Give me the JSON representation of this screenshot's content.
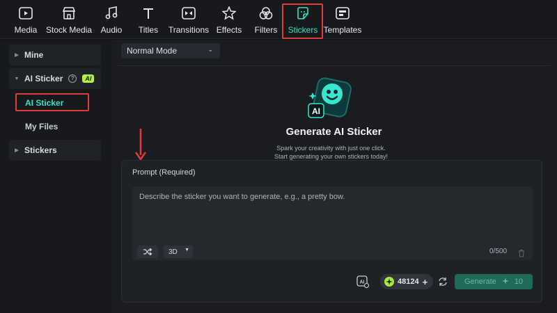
{
  "toolbar": {
    "tabs": [
      {
        "label": "Media",
        "icon": "media-icon"
      },
      {
        "label": "Stock Media",
        "icon": "stock-media-icon"
      },
      {
        "label": "Audio",
        "icon": "music-note-icon"
      },
      {
        "label": "Titles",
        "icon": "titles-icon"
      },
      {
        "label": "Transitions",
        "icon": "transitions-icon"
      },
      {
        "label": "Effects",
        "icon": "effects-icon"
      },
      {
        "label": "Filters",
        "icon": "filters-icon"
      },
      {
        "label": "Stickers",
        "icon": "sticker-icon"
      },
      {
        "label": "Templates",
        "icon": "templates-icon"
      }
    ],
    "active_tab": "Stickers",
    "accent": "#35e0c2"
  },
  "sidebar": {
    "mine": "Mine",
    "ai_sticker": "AI Sticker",
    "ai_badge": "AI",
    "help_glyph": "?",
    "sub_ai_sticker": "AI Sticker",
    "sub_my_files": "My Files",
    "stickers": "Stickers"
  },
  "main": {
    "mode_select": "Normal Mode",
    "title": "Generate AI Sticker",
    "subtitle_1": "Spark your creativity with just one click.",
    "subtitle_2": "Start generating your own stickers today!",
    "logo_badge": "AI",
    "prompt_label": "Prompt (Required)",
    "prompt_placeholder": "Describe the sticker you want to generate, e.g., a pretty bow.",
    "style_select": "3D",
    "counter": "0/500",
    "credits": "48124",
    "credits_plus": "+",
    "generate_label": "Generate",
    "generate_cost": "10"
  },
  "annotations": {
    "highlight_color": "#e23b3b"
  }
}
